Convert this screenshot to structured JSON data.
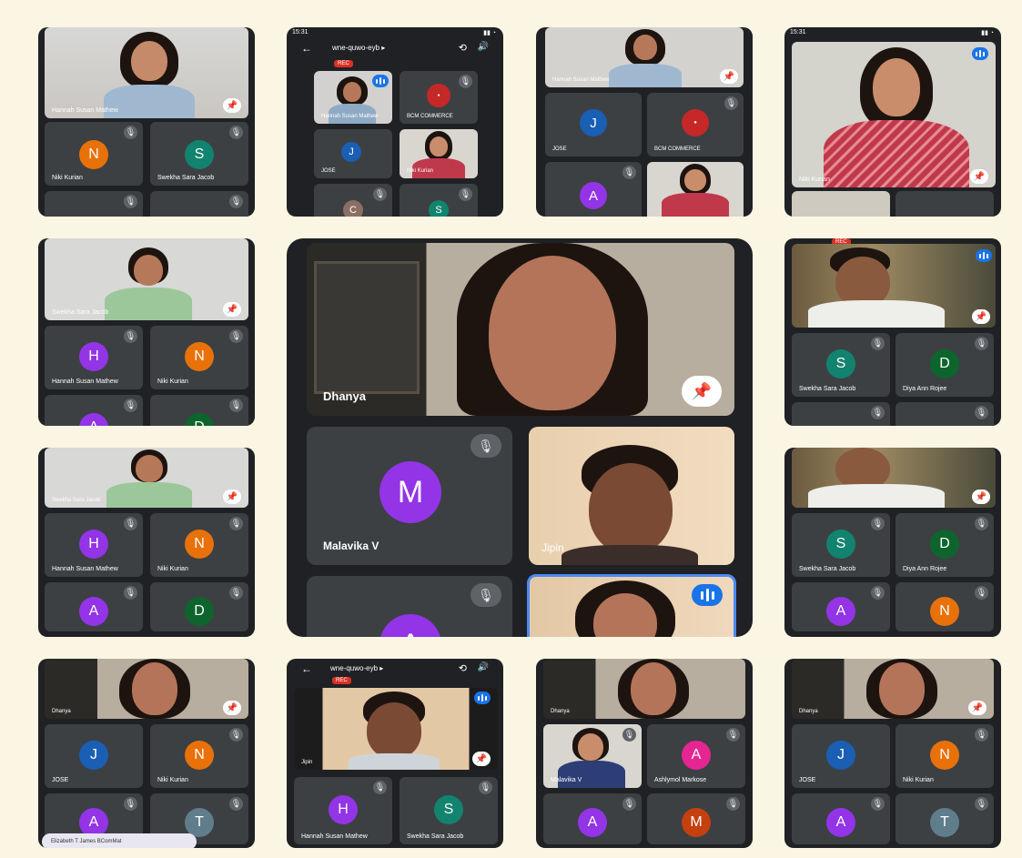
{
  "status": {
    "time": "15:31"
  },
  "meeting": {
    "code": "wne-quwo-eyb ▸",
    "rec": "REC"
  },
  "names": {
    "hannah": "Hannah Susan Mathew",
    "niki": "Niki Kurian",
    "swekha": "Swekha Sara Jacob",
    "jose": "JOSE",
    "bcm": "BCM COMMERCE",
    "dhanya": "Dhanya",
    "malavika": "Malavika V",
    "jipin": "Jipin",
    "diya": "Diya Ann Rojee",
    "ashly": "Ashlymol Markose",
    "elizabeth": "Elizabeth T James BComMat"
  },
  "letters": {
    "n": "N",
    "s": "S",
    "j": "J",
    "h": "H",
    "a": "A",
    "d": "D",
    "c": "C",
    "m": "M",
    "t": "T"
  },
  "colors": {
    "background": "#fbf6e3",
    "panel": "#202124",
    "tile": "#3c4043",
    "orange": "#e8710a",
    "teal": "#12836e",
    "blue": "#1a5fb4",
    "purple": "#9334e6",
    "darkgreen": "#0d652d",
    "red": "#d93025",
    "brown": "#8d6e63",
    "slate": "#607d8b",
    "pink": "#e52592",
    "rust": "#c5400f"
  },
  "icons": [
    "mic-off-icon",
    "pin-icon",
    "speaking-icon",
    "back-arrow-icon",
    "camera-switch-icon",
    "speaker-icon"
  ]
}
